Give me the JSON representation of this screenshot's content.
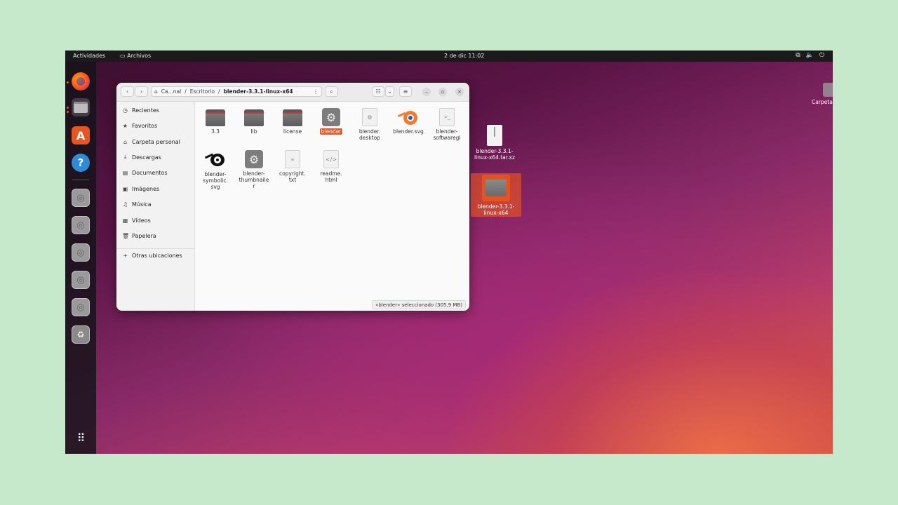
{
  "topbar": {
    "activities": "Actividades",
    "app_name": "Archivos",
    "clock": "2 de dic  11:02"
  },
  "window": {
    "path": {
      "home": "Ca...nal",
      "mid": "Escritorio",
      "current": "blender-3.3.1-linux-x64"
    },
    "sidebar": [
      {
        "label": "Recientes",
        "icon": "clock-icon"
      },
      {
        "label": "Favoritos",
        "icon": "star-icon"
      },
      {
        "label": "Carpeta personal",
        "icon": "home-icon"
      },
      {
        "label": "Descargas",
        "icon": "download-icon"
      },
      {
        "label": "Documentos",
        "icon": "document-icon"
      },
      {
        "label": "Imágenes",
        "icon": "image-icon"
      },
      {
        "label": "Música",
        "icon": "music-icon"
      },
      {
        "label": "Vídeos",
        "icon": "video-icon"
      },
      {
        "label": "Papelera",
        "icon": "trash-icon"
      }
    ],
    "other_locations": "Otras ubicaciones",
    "files": [
      {
        "name": "3.3",
        "kind": "folder"
      },
      {
        "name": "lib",
        "kind": "folder"
      },
      {
        "name": "license",
        "kind": "folder"
      },
      {
        "name": "blender",
        "kind": "executable",
        "selected": true
      },
      {
        "name": "blender.\ndesktop",
        "kind": "desktop"
      },
      {
        "name": "blender.svg",
        "kind": "blender-logo"
      },
      {
        "name": "blender-\nsoftwaregl",
        "kind": "script"
      },
      {
        "name": "blender-\nsymbolic.\nsvg",
        "kind": "blender-symbolic"
      },
      {
        "name": "blender-\nthumbnaile\nr",
        "kind": "executable"
      },
      {
        "name": "copyright.\ntxt",
        "kind": "text"
      },
      {
        "name": "readme.\nhtml",
        "kind": "html"
      }
    ],
    "status": "«blender» seleccionado  (305,9 MB)"
  },
  "desktop": {
    "items": [
      {
        "name": "blender-3.3.1-\nlinux-x64.tar.xz"
      },
      {
        "name": "blender-3.3.1-\nlinux-x64"
      },
      {
        "name": "Carpeta"
      }
    ]
  },
  "colors": {
    "accent": "#e95420",
    "folder_tab": "#c0393b"
  }
}
